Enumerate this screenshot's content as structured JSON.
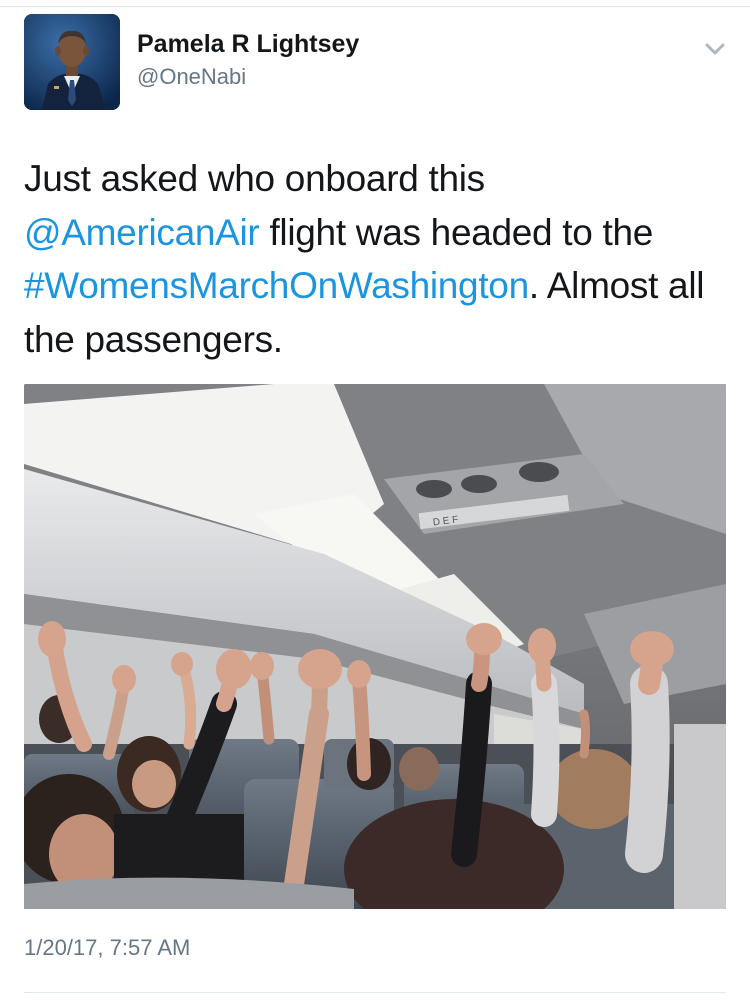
{
  "tweet": {
    "author": {
      "display_name": "Pamela R Lightsey",
      "handle": "@OneNabi",
      "avatar_icon": "profile-photo"
    },
    "text": {
      "part1": "Just asked who onboard this ",
      "mention": "@AmericanAir",
      "part2": " flight was headed to the ",
      "hashtag": "#WomensMarchOnWashington",
      "part3": ". Almost all the passengers."
    },
    "media_icon": "photo-airplane-cabin-passengers-raising-hands",
    "overhead_panel_label": "D E F",
    "timestamp": "1/20/17, 7:57 AM",
    "menu_icon": "chevron-down-icon"
  },
  "colors": {
    "link": "#1b95e0",
    "text": "#14171a",
    "secondary": "#657786",
    "divider": "#e1e8ed"
  }
}
